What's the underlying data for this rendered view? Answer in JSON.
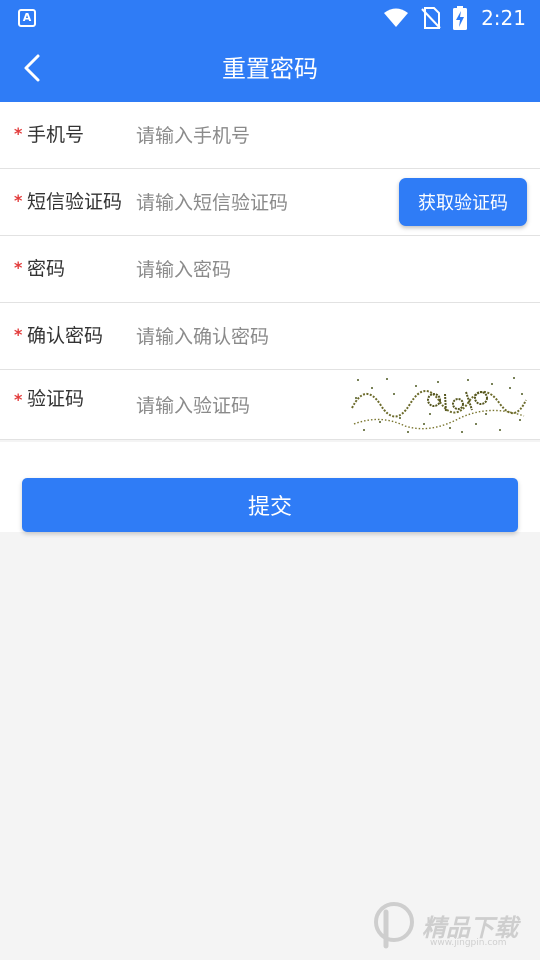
{
  "status_bar": {
    "time": "2:21",
    "left_icon": "A"
  },
  "header": {
    "title": "重置密码"
  },
  "form": {
    "rows": [
      {
        "label": "手机号",
        "placeholder": "请输入手机号",
        "required_mark": "*"
      },
      {
        "label": "短信验证码",
        "placeholder": "请输入短信验证码",
        "required_mark": "*"
      },
      {
        "label": "密码",
        "placeholder": "请输入密码",
        "required_mark": "*"
      },
      {
        "label": "确认密码",
        "placeholder": "请输入确认密码",
        "required_mark": "*"
      },
      {
        "label": "验证码",
        "placeholder": "请输入验证码",
        "required_mark": "*"
      }
    ],
    "sms_button_label": "获取验证码"
  },
  "submit": {
    "label": "提交"
  },
  "watermark": {
    "text": "精品下载",
    "url": "www.jingpin.com"
  },
  "colors": {
    "primary": "#2f7cf6",
    "required": "#e23b3b",
    "background": "#f4f4f4",
    "placeholder": "#8a8a8a",
    "label": "#333333"
  },
  "icons": {
    "status_left": "accessibility-a-icon",
    "wifi": "wifi-icon",
    "sim": "no-sim-icon",
    "battery": "battery-charging-icon",
    "back": "chevron-left-icon",
    "watermark": "watermark-logo-icon"
  }
}
